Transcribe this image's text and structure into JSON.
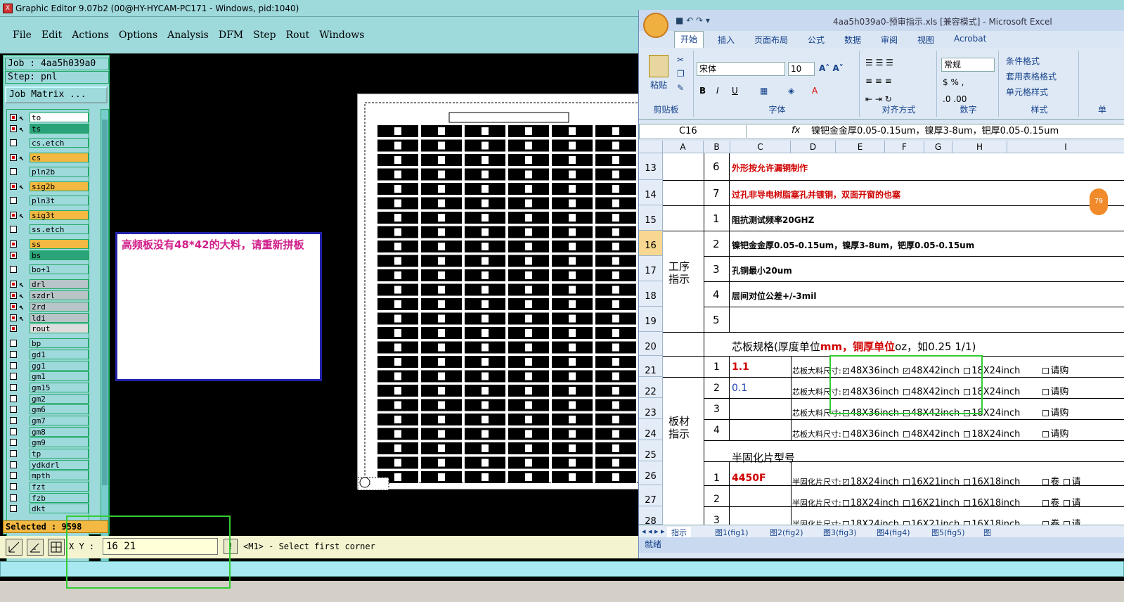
{
  "ge": {
    "title": "Graphic Editor 9.07b2 (00@HY-HYCAM-PC171 - Windows, pid:1040)",
    "menu": [
      "File",
      "Edit",
      "Actions",
      "Options",
      "Analysis",
      "DFM",
      "Step",
      "Rout",
      "Windows"
    ],
    "job": "Job : 4aa5h039a0",
    "step": "Step: pnl",
    "job_matrix": "Job Matrix ...",
    "layers": [
      {
        "n": "to",
        "c": "#ffffff",
        "arrow": true,
        "on": true
      },
      {
        "n": "ts",
        "c": "#2aa27a",
        "arrow": true,
        "on": true
      },
      {
        "n": "cs.etch",
        "c": "#9ed9dc",
        "arrow": false,
        "on": false
      },
      {
        "n": "cs",
        "c": "#f4b942",
        "arrow": true,
        "on": true
      },
      {
        "n": "pln2b",
        "c": "#9ed9dc",
        "arrow": false,
        "on": false
      },
      {
        "n": "sig2b",
        "c": "#f4b942",
        "arrow": true,
        "on": true
      },
      {
        "n": "pln3t",
        "c": "#9ed9dc",
        "arrow": false,
        "on": false
      },
      {
        "n": "sig3t",
        "c": "#f4b942",
        "arrow": true,
        "on": true
      },
      {
        "n": "ss.etch",
        "c": "#9ed9dc",
        "arrow": false,
        "on": false
      },
      {
        "n": "ss",
        "c": "#f4b942",
        "arrow": false,
        "on": true
      },
      {
        "n": "bs",
        "c": "#2aa27a",
        "arrow": false,
        "on": true
      },
      {
        "n": "bo+1",
        "c": "#9ed9dc",
        "arrow": false,
        "on": false
      },
      {
        "n": "drl",
        "c": "#b8c4c8",
        "arrow": true,
        "on": true
      },
      {
        "n": "szdrl",
        "c": "#b8c4c8",
        "arrow": true,
        "on": true
      },
      {
        "n": "2rd",
        "c": "#b8c4c8",
        "arrow": true,
        "on": true
      },
      {
        "n": "ldi",
        "c": "#b8c4c8",
        "arrow": true,
        "on": true
      },
      {
        "n": "rout",
        "c": "#dddddd",
        "arrow": false,
        "on": true
      },
      {
        "n": "bp",
        "c": "#9ed9dc",
        "arrow": false,
        "on": false
      },
      {
        "n": "gd1",
        "c": "#9ed9dc",
        "arrow": false,
        "on": false
      },
      {
        "n": "gg1",
        "c": "#9ed9dc",
        "arrow": false,
        "on": false
      },
      {
        "n": "gm1",
        "c": "#9ed9dc",
        "arrow": false,
        "on": false
      },
      {
        "n": "gm15",
        "c": "#9ed9dc",
        "arrow": false,
        "on": false
      },
      {
        "n": "gm2",
        "c": "#9ed9dc",
        "arrow": false,
        "on": false
      },
      {
        "n": "gm6",
        "c": "#9ed9dc",
        "arrow": false,
        "on": false
      },
      {
        "n": "gm7",
        "c": "#9ed9dc",
        "arrow": false,
        "on": false
      },
      {
        "n": "gm8",
        "c": "#9ed9dc",
        "arrow": false,
        "on": false
      },
      {
        "n": "gm9",
        "c": "#9ed9dc",
        "arrow": false,
        "on": false
      },
      {
        "n": "tp",
        "c": "#9ed9dc",
        "arrow": false,
        "on": false
      },
      {
        "n": "ydkdrl",
        "c": "#9ed9dc",
        "arrow": false,
        "on": false
      },
      {
        "n": "mpth",
        "c": "#9ed9dc",
        "arrow": false,
        "on": false
      },
      {
        "n": "fzt",
        "c": "#9ed9dc",
        "arrow": false,
        "on": false
      },
      {
        "n": "fzb",
        "c": "#9ed9dc",
        "arrow": false,
        "on": false
      },
      {
        "n": "dkt",
        "c": "#9ed9dc",
        "arrow": false,
        "on": false
      }
    ],
    "selected": "Selected : 9598",
    "xy_label": "X Y :",
    "xy_value": "16 21",
    "bang": "!",
    "prompt": "<M1> - Select first corner",
    "popup": "高频板没有48*42的大料，请重新拼板"
  },
  "excel": {
    "title": "4aa5h039a0-预审指示.xls [兼容模式] - Microsoft Excel",
    "tabs": [
      "开始",
      "插入",
      "页面布局",
      "公式",
      "数据",
      "审阅",
      "视图",
      "Acrobat"
    ],
    "groups": [
      "剪贴板",
      "字体",
      "对齐方式",
      "数字",
      "样式",
      "单"
    ],
    "paste": "粘贴",
    "font": "宋体",
    "size": "10",
    "numfmt": "常规",
    "styles": [
      "条件格式",
      "套用表格格式",
      "单元格样式"
    ],
    "namebox": "C16",
    "fx": "fx",
    "formula": "镍钯金金厚0.05-0.15um，镍厚3-8um，钯厚0.05-0.15um",
    "cols": [
      "A",
      "B",
      "C",
      "D",
      "E",
      "F",
      "G",
      "H",
      "I"
    ],
    "rows": [
      "13",
      "14",
      "15",
      "16",
      "17",
      "18",
      "19",
      "20",
      "21",
      "22",
      "23",
      "24",
      "25",
      "26",
      "27",
      "28"
    ],
    "sec_process": "工序指示",
    "sec_board": "板材指示",
    "r13": {
      "n": "6",
      "t": "外形按允许漏铜制作"
    },
    "r14": {
      "n": "7",
      "t": "过孔非导电树脂塞孔并镀铜，双面开窗的也塞"
    },
    "r15": {
      "n": "1",
      "t": "阻抗测试频率20GHZ"
    },
    "r16": {
      "n": "2",
      "t": "镍钯金金厚0.05-0.15um，镍厚3-8um，钯厚0.05-0.15um"
    },
    "r17": {
      "n": "3",
      "t": "孔铜最小20um"
    },
    "r18": {
      "n": "4",
      "t": "层间对位公差+/-3mil"
    },
    "r19": {
      "n": "5",
      "t": ""
    },
    "r20": {
      "a": "芯板规格(厚度单位",
      "b": "mm，铜厚单位",
      "c": "oz，如0.25 1/1)"
    },
    "core_label": "芯板大料尺寸:",
    "core_opts": [
      "48X36inch",
      "48X42inch",
      "18X24inch",
      "请购"
    ],
    "core_rows": [
      {
        "n": "1",
        "v": "1.1",
        "chk": [
          true,
          true,
          false,
          false
        ]
      },
      {
        "n": "2",
        "v": "0.1",
        "chk": [
          true,
          false,
          false,
          false
        ]
      },
      {
        "n": "3",
        "v": "",
        "chk": [
          false,
          false,
          false,
          false
        ]
      },
      {
        "n": "4",
        "v": "",
        "chk": [
          false,
          false,
          false,
          false
        ]
      }
    ],
    "r25": "半固化片型号",
    "pp_label": "半固化片尺寸:",
    "pp_opts": [
      "18X24inch",
      "16X21inch",
      "16X18inch",
      "卷",
      "请"
    ],
    "pp_rows": [
      {
        "n": "1",
        "v": "4450F",
        "chk": [
          true,
          false,
          false,
          false
        ]
      },
      {
        "n": "2",
        "v": "",
        "chk": [
          false,
          false,
          false,
          false
        ]
      },
      {
        "n": "3",
        "v": "",
        "chk": [
          false,
          false,
          false,
          false
        ]
      }
    ],
    "sheets": [
      "指示",
      "图1(fig1)",
      "图2(fig2)",
      "图3(fig3)",
      "图4(fig4)",
      "图5(fig5)",
      "图"
    ],
    "status": "就绪",
    "badge": "79"
  }
}
